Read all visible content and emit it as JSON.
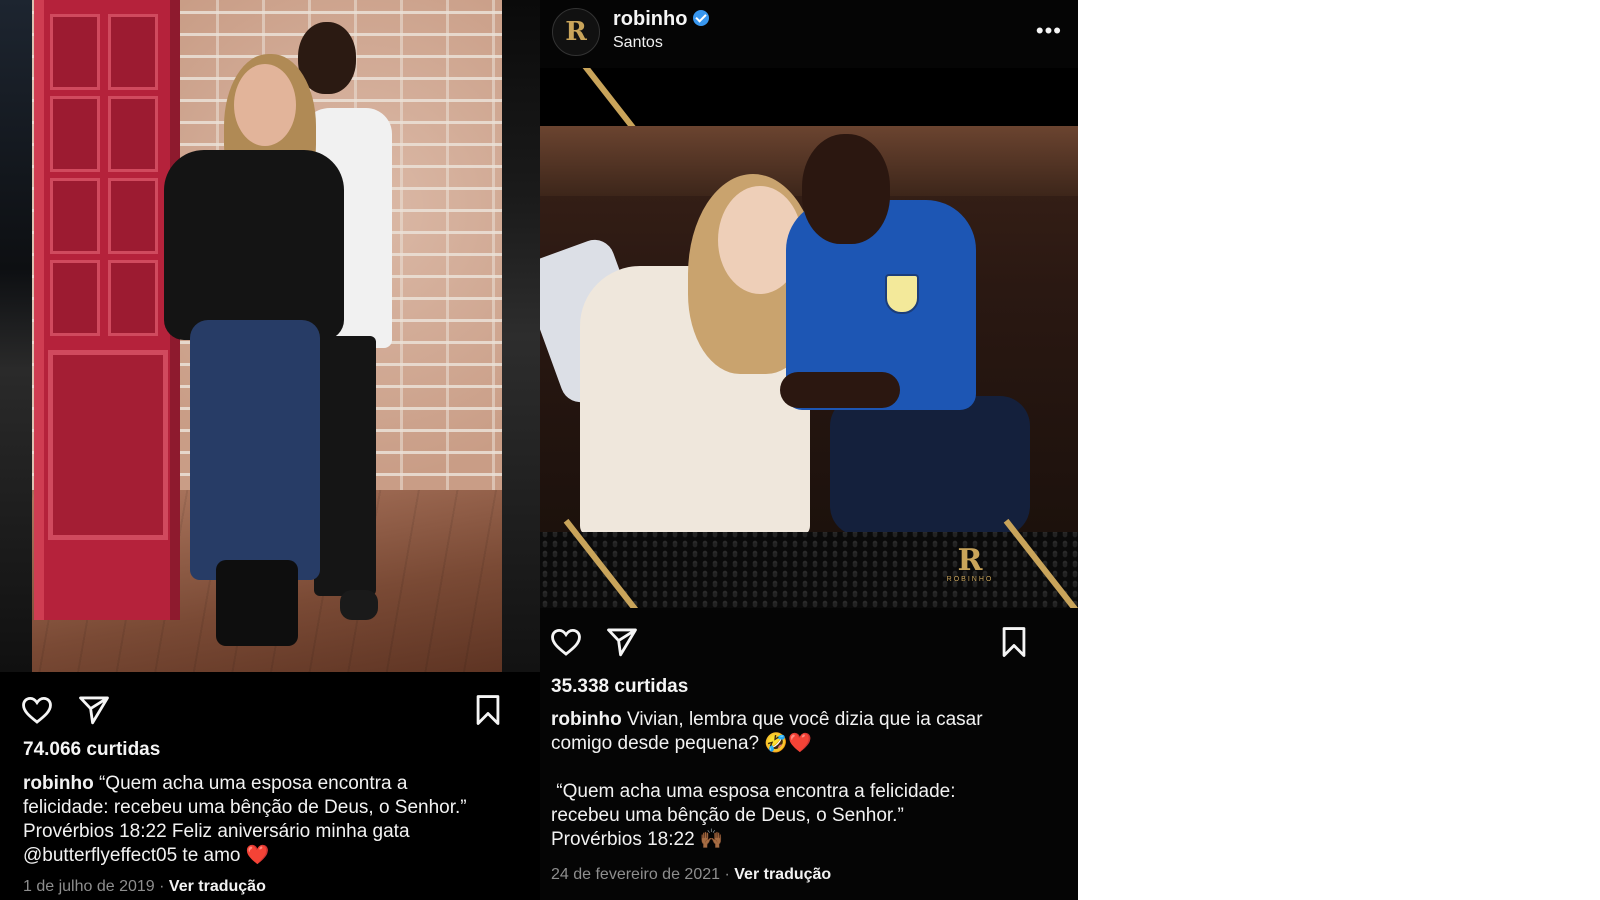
{
  "left_post": {
    "likes": "74.066 curtidas",
    "caption_user": "robinho",
    "caption_lines": [
      "“Quem acha uma esposa encontra a",
      "felicidade: recebeu uma bênção de Deus, o Senhor.”",
      "Provérbios 18:22 Feliz aniversário minha gata",
      "@butterflyeffect05  te amo ❤️"
    ],
    "date": "1 de julho de 2019",
    "separator": "·",
    "translate": "Ver tradução"
  },
  "right_post": {
    "username": "robinho",
    "location": "Santos",
    "more": "•••",
    "avatar_letter": "R",
    "brand_letter": "R",
    "brand_word": "ROBINHO",
    "likes": "35.338 curtidas",
    "caption_user": "robinho",
    "caption_lines": [
      "Vivian,  lembra que você dizia que ia casar",
      "comigo desde pequena? 🤣❤️",
      "",
      " “Quem acha uma esposa encontra a felicidade:",
      "recebeu uma bênção de Deus, o Senhor.”",
      "Provérbios 18:22 🙌🏾"
    ],
    "date": "24 de fevereiro de 2021",
    "separator": "·",
    "translate": "Ver tradução"
  },
  "icons": [
    "heart-icon",
    "send-icon",
    "bookmark-icon",
    "verified-badge-icon",
    "more-options-icon"
  ],
  "colors": {
    "background": "#000000",
    "verified": "#3897f0",
    "gold": "#c9a45a",
    "muted_text": "#8e8e8e"
  }
}
